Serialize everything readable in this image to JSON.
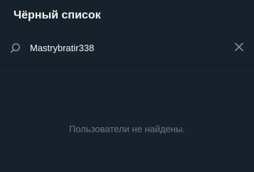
{
  "header": {
    "title": "Чёрный список"
  },
  "search": {
    "icon": "search-icon",
    "value": "Mastrybratir338",
    "clear_icon": "close-icon"
  },
  "empty_state": {
    "message": "Пользователи не найдены."
  },
  "colors": {
    "background": "#17212b",
    "title_text": "#f5f5f5",
    "muted_text": "#6d7883",
    "icon": "#7f8b96",
    "divider": "#101921"
  }
}
